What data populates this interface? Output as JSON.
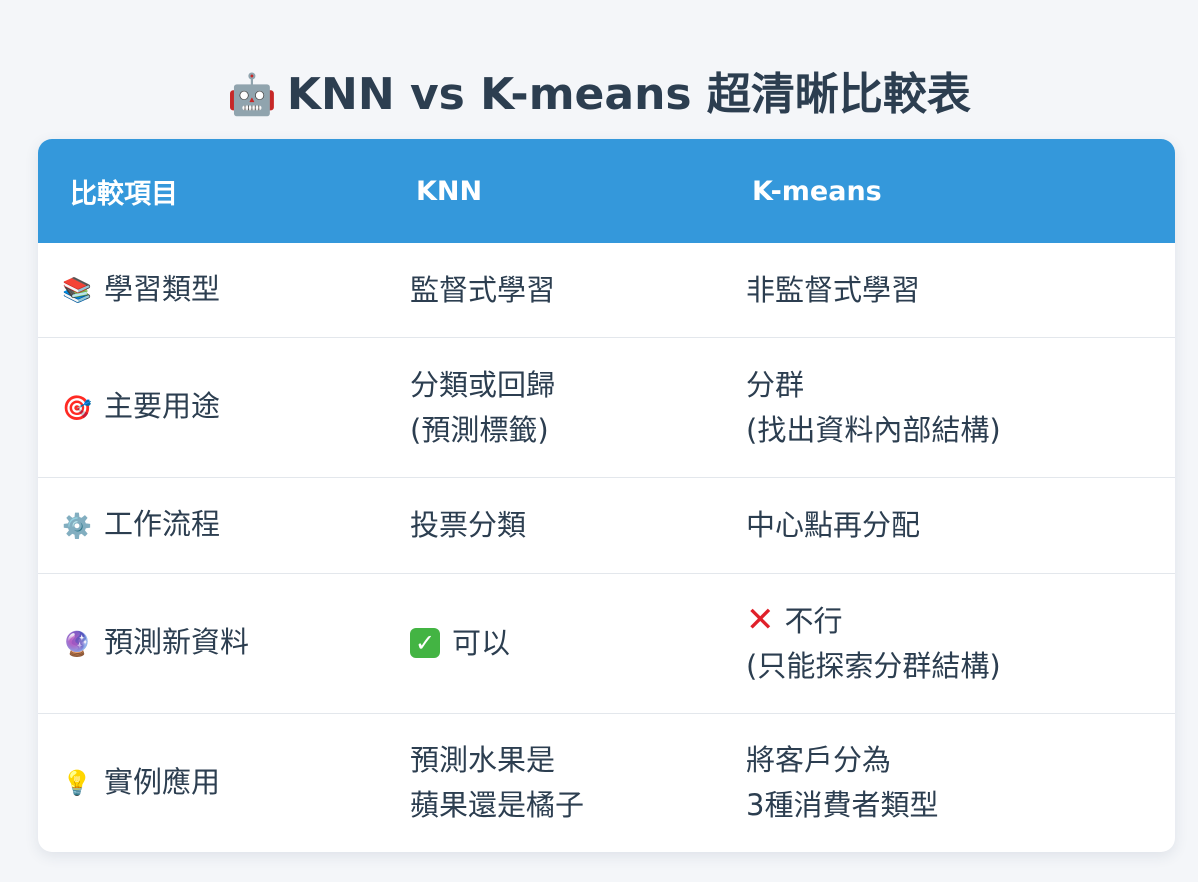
{
  "title": {
    "icon": "robot-icon",
    "emoji": "🤖",
    "text": "KNN vs K-means 超清晰比較表"
  },
  "table": {
    "headers": [
      "比較項目",
      "KNN",
      "K-means"
    ],
    "rows": [
      {
        "icon": "books-icon",
        "emoji": "📚",
        "label": "學習類型",
        "knn": [
          "監督式學習"
        ],
        "kmeans": [
          "非監督式學習"
        ]
      },
      {
        "icon": "target-icon",
        "emoji": "🎯",
        "label": "主要用途",
        "knn": [
          "分類或回歸",
          "(預測標籤)"
        ],
        "kmeans": [
          "分群",
          "(找出資料內部結構)"
        ]
      },
      {
        "icon": "gear-icon",
        "emoji": "⚙️",
        "label": "工作流程",
        "knn": [
          "投票分類"
        ],
        "kmeans": [
          "中心點再分配"
        ]
      },
      {
        "icon": "crystal-ball-icon",
        "emoji": "🔮",
        "label": "預測新資料",
        "knn": [
          "可以"
        ],
        "knn_mark": "check-icon",
        "kmeans": [
          "不行",
          "(只能探索分群結構)"
        ],
        "kmeans_mark": "cross-icon"
      },
      {
        "icon": "light-bulb-icon",
        "emoji": "💡",
        "label": "實例應用",
        "knn": [
          "預測水果是",
          "蘋果還是橘子"
        ],
        "kmeans": [
          "將客戶分為",
          "3種消費者類型"
        ]
      }
    ]
  },
  "colors": {
    "header_bg": "#3498db",
    "title_text": "#2c3e50",
    "check": "#43b443",
    "cross": "#e0202a"
  }
}
